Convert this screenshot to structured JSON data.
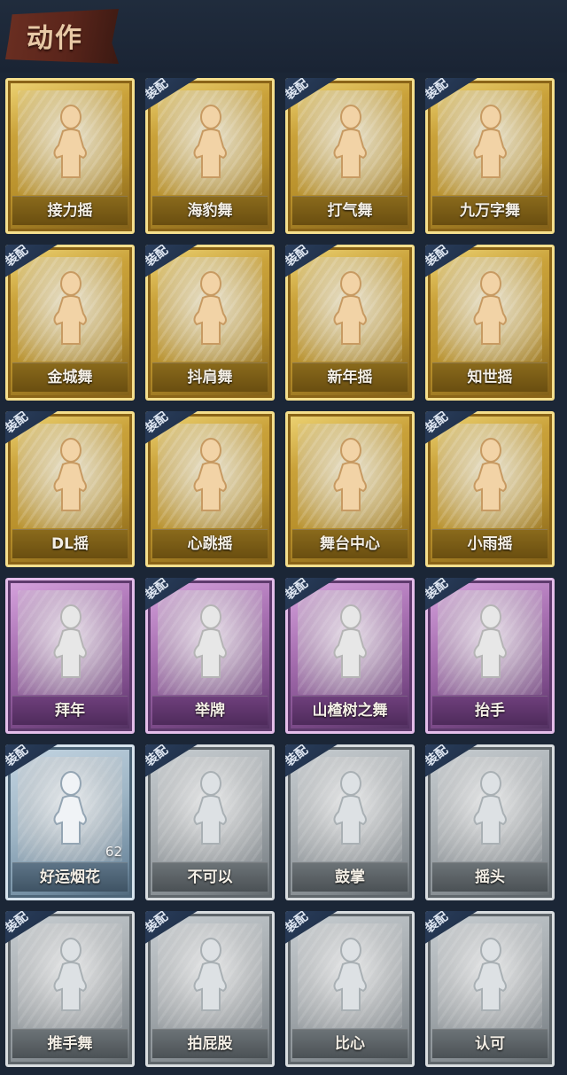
{
  "header": {
    "title": "动作"
  },
  "equip_tag": "装配",
  "cards": [
    {
      "label": "接力摇",
      "rarity": "gold",
      "equipped": false
    },
    {
      "label": "海豹舞",
      "rarity": "gold",
      "equipped": true
    },
    {
      "label": "打气舞",
      "rarity": "gold",
      "equipped": true
    },
    {
      "label": "九万字舞",
      "rarity": "gold",
      "equipped": true
    },
    {
      "label": "金城舞",
      "rarity": "gold",
      "equipped": true
    },
    {
      "label": "抖肩舞",
      "rarity": "gold",
      "equipped": true
    },
    {
      "label": "新年摇",
      "rarity": "gold",
      "equipped": true
    },
    {
      "label": "知世摇",
      "rarity": "gold",
      "equipped": true
    },
    {
      "label": "DL摇",
      "rarity": "gold",
      "equipped": true
    },
    {
      "label": "心跳摇",
      "rarity": "gold",
      "equipped": true
    },
    {
      "label": "舞台中心",
      "rarity": "gold",
      "equipped": false
    },
    {
      "label": "小雨摇",
      "rarity": "gold",
      "equipped": true
    },
    {
      "label": "拜年",
      "rarity": "purple",
      "equipped": false
    },
    {
      "label": "举牌",
      "rarity": "purple",
      "equipped": true
    },
    {
      "label": "山楂树之舞",
      "rarity": "purple",
      "equipped": true
    },
    {
      "label": "抬手",
      "rarity": "purple",
      "equipped": true
    },
    {
      "label": "好运烟花",
      "rarity": "blue",
      "equipped": true,
      "count": "62"
    },
    {
      "label": "不可以",
      "rarity": "grey",
      "equipped": true
    },
    {
      "label": "鼓掌",
      "rarity": "grey",
      "equipped": true
    },
    {
      "label": "摇头",
      "rarity": "grey",
      "equipped": true
    },
    {
      "label": "推手舞",
      "rarity": "grey",
      "equipped": true
    },
    {
      "label": "拍屁股",
      "rarity": "grey",
      "equipped": true
    },
    {
      "label": "比心",
      "rarity": "grey",
      "equipped": true
    },
    {
      "label": "认可",
      "rarity": "grey",
      "equipped": true
    }
  ]
}
